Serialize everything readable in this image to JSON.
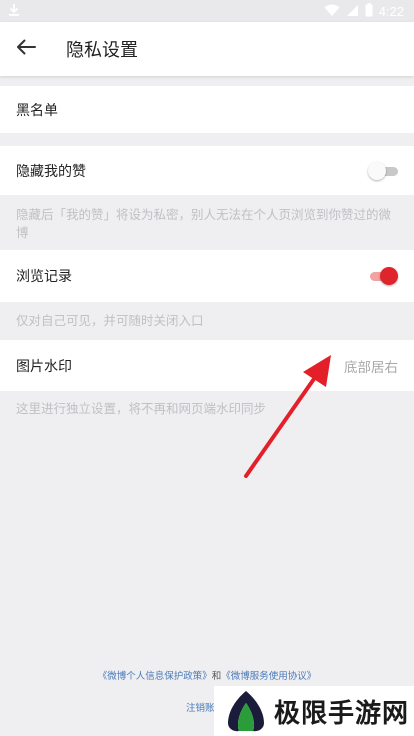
{
  "status_bar": {
    "time": "4:22",
    "icons": [
      "download-icon",
      "wifi-icon",
      "signal-icon",
      "battery-icon"
    ]
  },
  "header": {
    "title": "隐私设置",
    "back_icon": "back-arrow-icon"
  },
  "settings": {
    "blacklist": {
      "label": "黑名单"
    },
    "hide_likes": {
      "label": "隐藏我的赞",
      "enabled": false,
      "hint": "隐藏后「我的赞」将设为私密，别人无法在个人页浏览到你赞过的微博"
    },
    "browse_history": {
      "label": "浏览记录",
      "enabled": true,
      "hint": "仅对自己可见，并可随时关闭入口"
    },
    "image_watermark": {
      "label": "图片水印",
      "value": "底部居右",
      "hint": "这里进行独立设置，将不再和网页端水印同步"
    }
  },
  "footer": {
    "privacy_policy_link": "《微博个人信息保护政策》",
    "and_text": "和",
    "service_agreement_link": "《微博服务使用协议》",
    "cancel_account_text": "注销账"
  },
  "watermark_overlay": {
    "text": "极限手游网"
  },
  "colors": {
    "accent": "#e0242b",
    "link": "#4a79b9",
    "annotation_arrow": "#e3202a"
  }
}
